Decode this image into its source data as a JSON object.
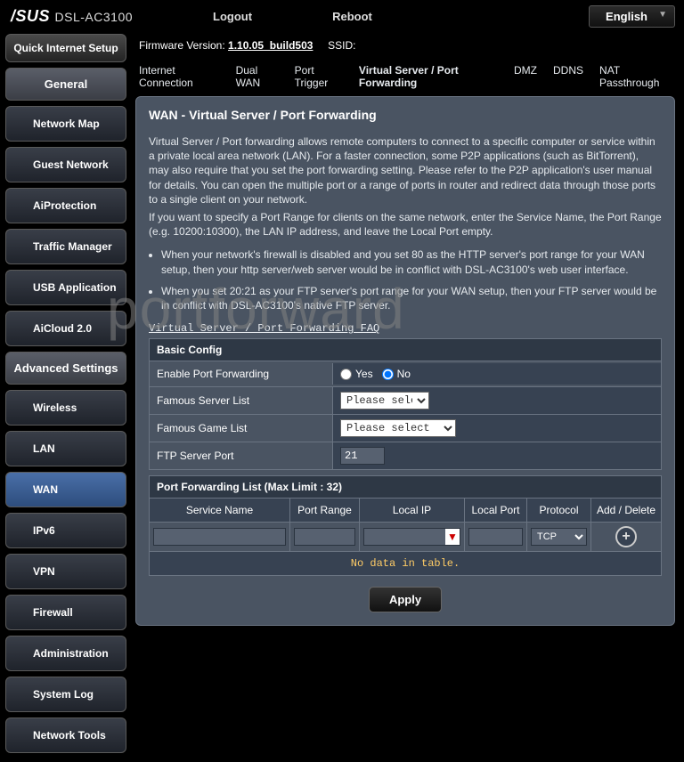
{
  "brand": "/SUS",
  "model": "DSL-AC3100",
  "top": {
    "logout": "Logout",
    "reboot": "Reboot",
    "lang": "English"
  },
  "fw": {
    "label": "Firmware Version:",
    "value": "1.10.05_build503",
    "ssid_label": "SSID:"
  },
  "tabs": {
    "internet": "Internet Connection",
    "dualwan": "Dual WAN",
    "porttrigger": "Port Trigger",
    "vserver": "Virtual Server / Port Forwarding",
    "dmz": "DMZ",
    "ddns": "DDNS",
    "nat": "NAT Passthrough"
  },
  "sidebar": {
    "quick": "Quick Internet Setup",
    "general": "General",
    "items1": [
      "Network Map",
      "Guest Network",
      "AiProtection",
      "Traffic Manager",
      "USB Application",
      "AiCloud 2.0"
    ],
    "advanced": "Advanced Settings",
    "items2": [
      "Wireless",
      "LAN",
      "WAN",
      "IPv6",
      "VPN",
      "Firewall",
      "Administration",
      "System Log",
      "Network Tools"
    ]
  },
  "page": {
    "title": "WAN - Virtual Server / Port Forwarding",
    "para1": "Virtual Server / Port forwarding allows remote computers to connect to a specific computer or service within a private local area network (LAN). For a faster connection, some P2P applications (such as BitTorrent), may also require that you set the port forwarding setting. Please refer to the P2P application's user manual for details. You can open the multiple port or a range of ports in router and redirect data through those ports to a single client on your network.",
    "para2": "If you want to specify a Port Range for clients on the same network, enter the Service Name, the Port Range (e.g. 10200:10300), the LAN IP address, and leave the Local Port empty.",
    "bullet1": "When your network's firewall is disabled and you set 80 as the HTTP server's port range for your WAN setup, then your http server/web server would be in conflict with DSL-AC3100's web user interface.",
    "bullet2": "When you set 20:21 as your FTP server's port range for your WAN setup, then your FTP server would be in conflict with DSL-AC3100's native FTP server.",
    "faq": "Virtual Server / Port Forwarding FAQ"
  },
  "basic": {
    "head": "Basic Config",
    "enable_label": "Enable Port Forwarding",
    "yes": "Yes",
    "no": "No",
    "famous_server_label": "Famous Server List",
    "famous_game_label": "Famous Game List",
    "please_select": "Please select",
    "ftp_label": "FTP Server Port",
    "ftp_value": "21"
  },
  "pf": {
    "head": "Port Forwarding List (Max Limit : 32)",
    "cols": {
      "svc": "Service Name",
      "pr": "Port Range",
      "ip": "Local IP",
      "lp": "Local Port",
      "proto": "Protocol",
      "ad": "Add / Delete"
    },
    "proto_val": "TCP",
    "nodata": "No data in table."
  },
  "apply": "Apply",
  "watermark": "portforward"
}
